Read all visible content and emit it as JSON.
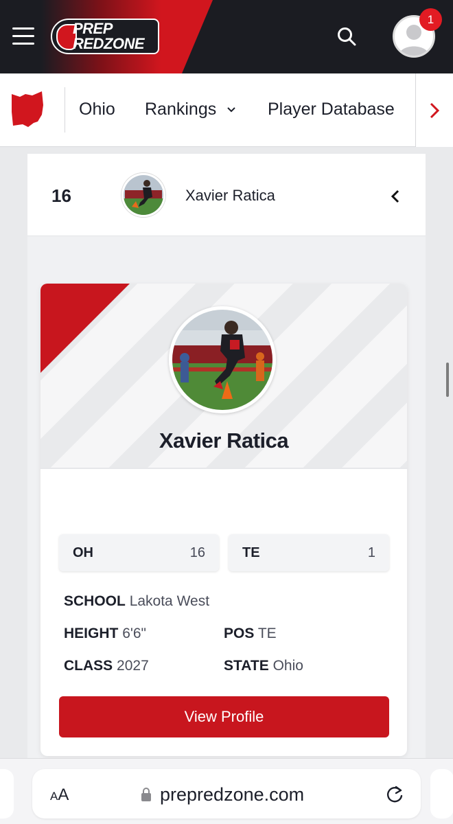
{
  "header": {
    "logo_line1": "PREP",
    "logo_line2": "REDZONE",
    "notification_count": "1"
  },
  "nav": {
    "items": [
      {
        "label": "Ohio"
      },
      {
        "label": "Rankings"
      },
      {
        "label": "Player Database"
      }
    ]
  },
  "ranking_row": {
    "rank": "16",
    "name": "Xavier Ratica"
  },
  "card": {
    "name": "Xavier Ratica",
    "stats": [
      {
        "key": "OH",
        "value": "16"
      },
      {
        "key": "TE",
        "value": "1"
      }
    ],
    "info": {
      "school_label": "SCHOOL",
      "school_value": "Lakota West",
      "height_label": "HEIGHT",
      "height_value": "6'6\"",
      "pos_label": "POS",
      "pos_value": "TE",
      "class_label": "CLASS",
      "class_value": "2027",
      "state_label": "STATE",
      "state_value": "Ohio"
    },
    "button_label": "View Profile"
  },
  "browser": {
    "aa_big": "A",
    "aa_small": "A",
    "url": "prepredzone.com"
  },
  "colors": {
    "brand_red": "#c8161e",
    "header_dark": "#1b1c22"
  }
}
